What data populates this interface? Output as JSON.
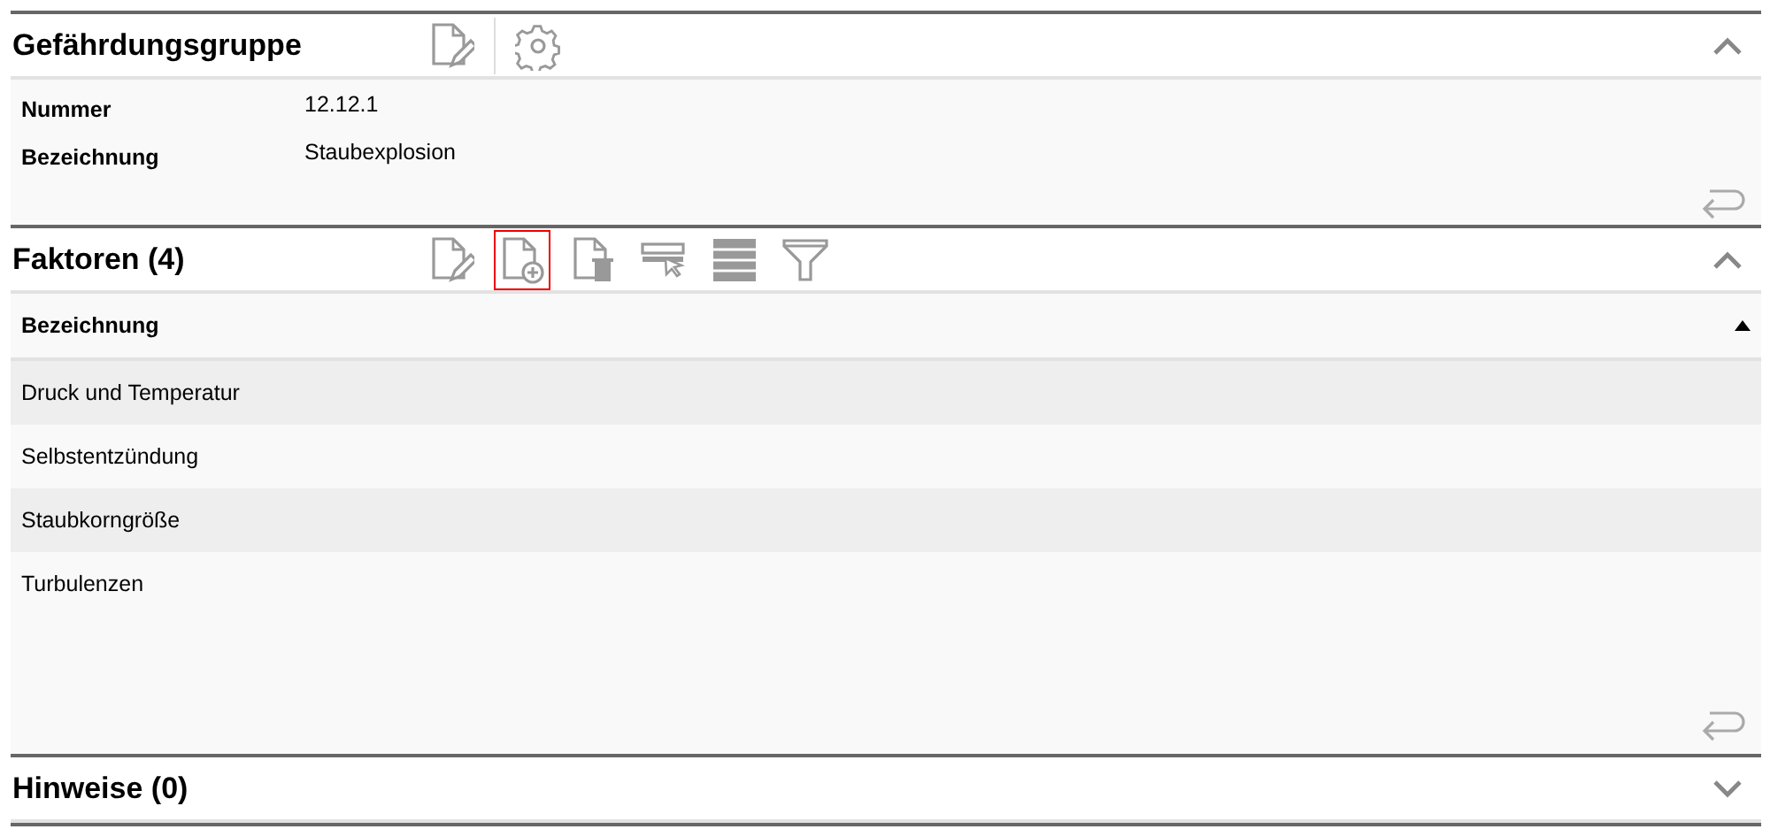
{
  "panels": [
    {
      "title": "Gefährdungsgruppe",
      "expanded": true,
      "tools": [
        {
          "kind": "edit",
          "selected": false
        },
        {
          "kind": "settings",
          "selected": false
        }
      ],
      "fields": [
        {
          "label": "Nummer",
          "value": "12.12.1"
        },
        {
          "label": "Bezeichnung",
          "value": "Staubexplosion"
        }
      ]
    },
    {
      "title": "Faktoren (4)",
      "expanded": true,
      "tools": [
        {
          "kind": "edit",
          "selected": false
        },
        {
          "kind": "add",
          "selected": true
        },
        {
          "kind": "delete",
          "selected": false
        },
        {
          "kind": "select-row",
          "selected": false
        },
        {
          "kind": "rows",
          "selected": false
        },
        {
          "kind": "filter",
          "selected": false
        }
      ],
      "table": {
        "columns": [
          {
            "label": "Bezeichnung",
            "sorted_ascending": true
          }
        ],
        "rows": [
          {
            "cells": [
              "Druck und Temperatur"
            ]
          },
          {
            "cells": [
              "Selbstentzündung"
            ]
          },
          {
            "cells": [
              "Staubkorngröße"
            ]
          },
          {
            "cells": [
              "Turbulenzen"
            ]
          }
        ]
      }
    },
    {
      "title": "Hinweise (0)",
      "expanded": false
    }
  ]
}
